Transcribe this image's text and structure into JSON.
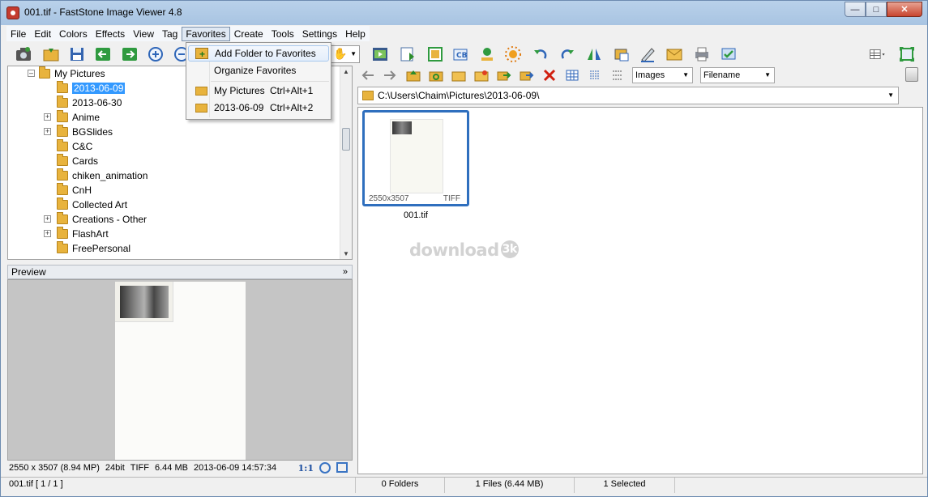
{
  "window": {
    "title": "001.tif  -  FastStone Image Viewer 4.8"
  },
  "menu": [
    "File",
    "Edit",
    "Colors",
    "Effects",
    "View",
    "Tag",
    "Favorites",
    "Create",
    "Tools",
    "Settings",
    "Help"
  ],
  "favorites_menu": {
    "add_folder": "Add Folder to Favorites",
    "organize": "Organize Favorites",
    "fav1_label": "My Pictures",
    "fav1_shortcut": "Ctrl+Alt+1",
    "fav2_label": "2013-06-09",
    "fav2_shortcut": "Ctrl+Alt+2"
  },
  "tree": {
    "root": "My Pictures",
    "items": [
      "2013-06-09",
      "2013-06-30",
      "Anime",
      "BGSlides",
      "C&C",
      "Cards",
      "chiken_animation",
      "CnH",
      "Collected Art",
      "Creations - Other",
      "FlashArt",
      "FreePersonal"
    ]
  },
  "preview": {
    "label": "Preview"
  },
  "info": {
    "dims": "2550 x 3507 (8.94 MP)",
    "bits": "24bit",
    "type": "TIFF",
    "size": "6.44 MB",
    "date": "2013-06-09 14:57:34",
    "zoom": "1:1"
  },
  "browser": {
    "filter": "Images",
    "sort": "Filename",
    "path": "C:\\Users\\Chaim\\Pictures\\2013-06-09\\"
  },
  "thumbnail": {
    "dims": "2550x3507",
    "type": "TIFF",
    "name": "001.tif"
  },
  "watermark": {
    "text": "download",
    "badge": "3k"
  },
  "status": {
    "file": "001.tif [ 1 / 1 ]",
    "folders": "0 Folders",
    "files": "1 Files (6.44 MB)",
    "selected": "1 Selected"
  }
}
